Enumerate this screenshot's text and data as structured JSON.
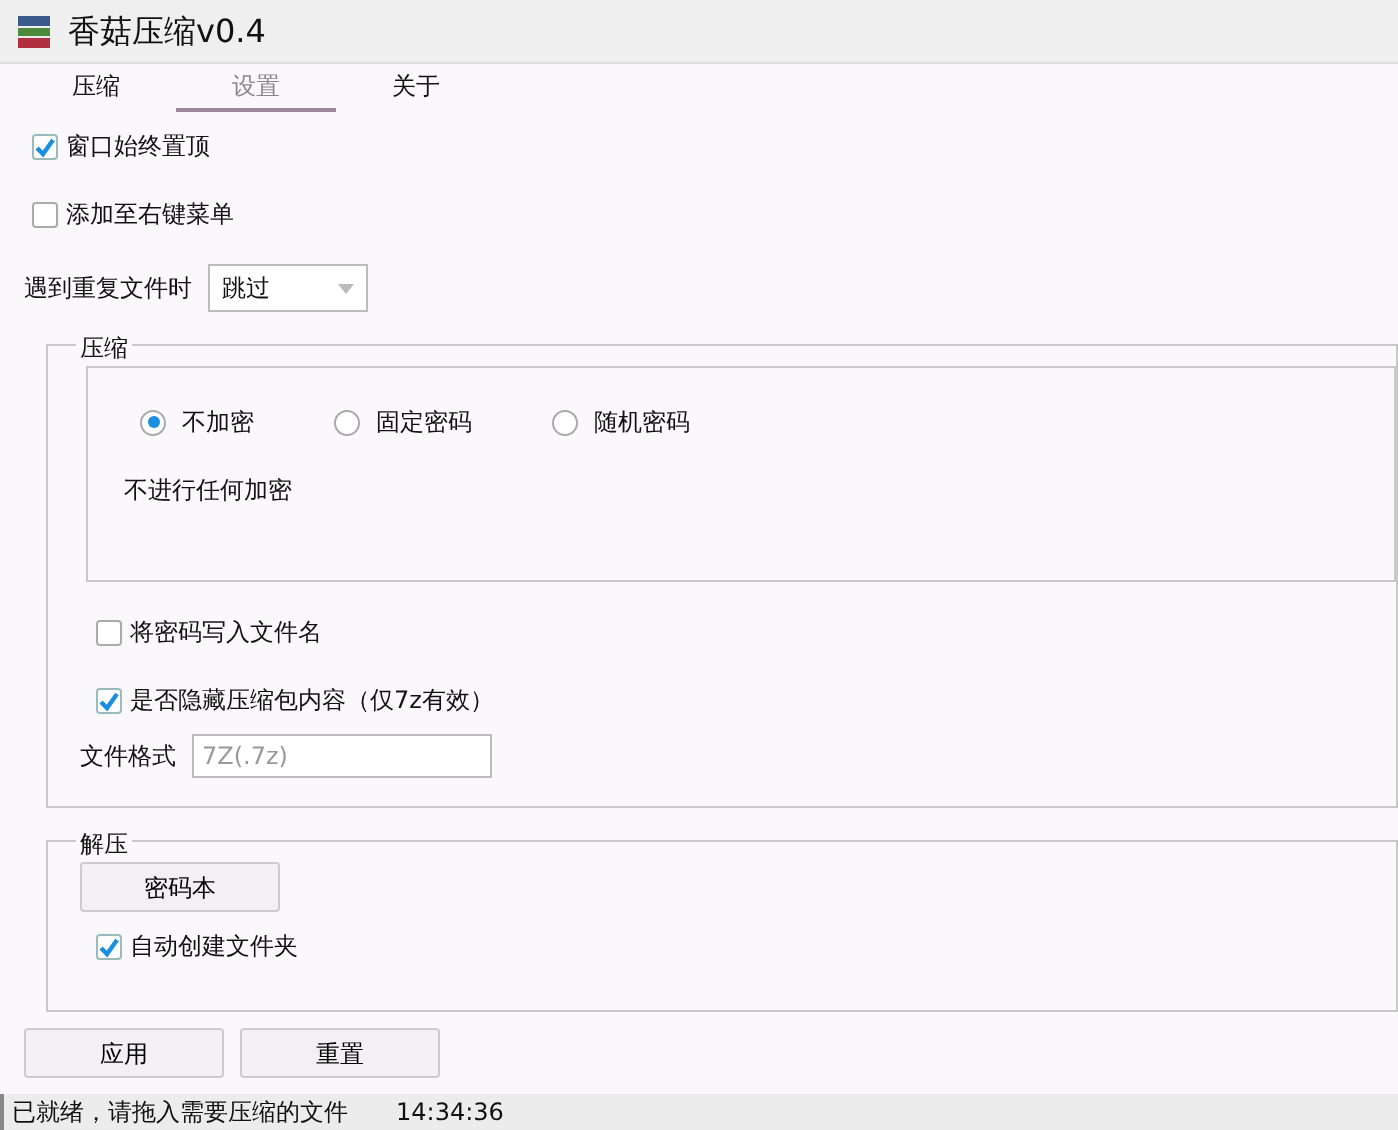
{
  "window": {
    "title": "香菇压缩v0.4"
  },
  "tabs": [
    {
      "label": "压缩",
      "selected": false
    },
    {
      "label": "设置",
      "selected": true
    },
    {
      "label": "关于",
      "selected": false
    }
  ],
  "options": [
    {
      "label": "窗口始终置顶",
      "checked": true
    },
    {
      "label": "添加至右键菜单",
      "checked": false
    }
  ],
  "duplicate": {
    "label": "遇到重复文件时",
    "value": "跳过"
  },
  "compress": {
    "title": "压缩",
    "encryption": [
      {
        "label": "不加密",
        "selected": true
      },
      {
        "label": "固定密码",
        "selected": false
      },
      {
        "label": "随机密码",
        "selected": false
      }
    ],
    "description": "不进行任何加密",
    "options": [
      {
        "label": "将密码写入文件名",
        "checked": false
      },
      {
        "label": "是否隐藏压缩包内容（仅7z有效）",
        "checked": true
      }
    ],
    "format": {
      "label": "文件格式",
      "value": "7Z(.7z)"
    }
  },
  "extract": {
    "title": "解压",
    "button": "密码本",
    "options": [
      {
        "label": "自动创建文件夹",
        "checked": true
      }
    ]
  },
  "buttons": [
    "应用",
    "重置"
  ],
  "status_bar": {
    "message": "已就绪，请拖入需要压缩的文件",
    "time": "14:34:36"
  }
}
